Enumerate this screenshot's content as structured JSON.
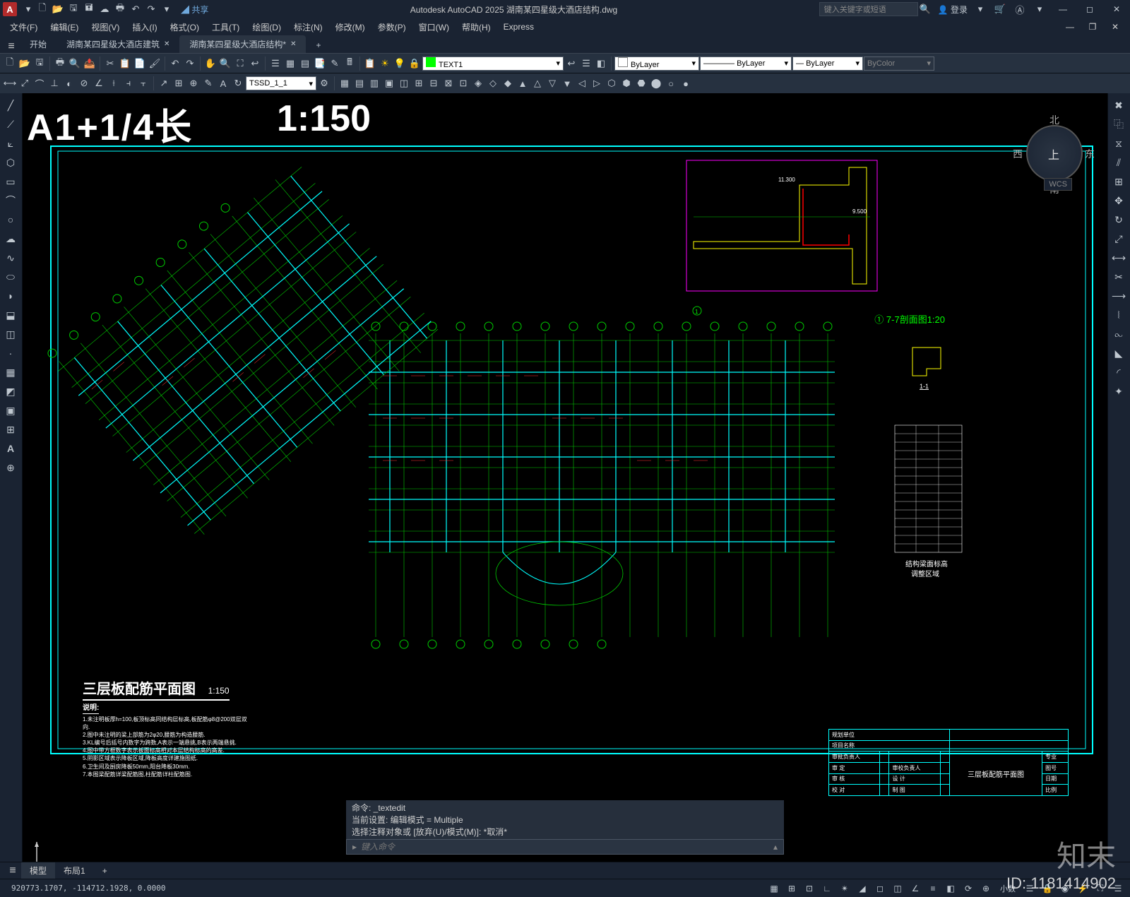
{
  "titlebar": {
    "app_letter": "A",
    "title": "Autodesk AutoCAD 2025   湖南某四星级大酒店结构.dwg",
    "share": "共享",
    "search_placeholder": "键入关键字或短语",
    "login": "登录"
  },
  "menus": [
    "文件(F)",
    "编辑(E)",
    "视图(V)",
    "插入(I)",
    "格式(O)",
    "工具(T)",
    "绘图(D)",
    "标注(N)",
    "修改(M)",
    "参数(P)",
    "窗口(W)",
    "帮助(H)",
    "Express"
  ],
  "tabs": {
    "items": [
      {
        "label": "开始",
        "active": false
      },
      {
        "label": "湖南某四星级大酒店建筑",
        "active": false
      },
      {
        "label": "湖南某四星级大酒店结构*",
        "active": true
      }
    ],
    "add": "+"
  },
  "toolbar1": {
    "layer_text": "TEXT1",
    "layer_color": "#00ff00",
    "bylayer1": "ByLayer",
    "bylayer2": "ByLayer",
    "bylayer3": "ByLayer",
    "bycolor": "ByColor"
  },
  "toolbar2": {
    "style": "TSSD_1_1"
  },
  "canvas": {
    "big_label": "A1+1/4长",
    "scale": "1:150",
    "drawing_title": "三层板配筋平面图",
    "drawing_scale": "1:150",
    "notes_title": "说明:",
    "notes_lines": [
      "1.未注明板厚h=100,板顶标高同结构层标高,板配筋φ8@200双层双向.",
      "2.图中未注明的梁上部筋为2φ20,腰筋为构造腰筋.",
      "3.KL编号后括号内数字为跨数,A表示一端悬挑,B表示两端悬挑.",
      "4.图中带方框数字表示板面标高相对本层结构标高的高差.",
      "5.阴影区域表示降板区域,降板高度详建施图纸.",
      "6.卫生间及厨房降板50mm,阳台降板30mm.",
      "7.本图梁配筋详梁配筋图,柱配筋详柱配筋图."
    ],
    "section_label": "①  7-7剖面图1:20",
    "compass": {
      "n": "北",
      "s": "南",
      "e": "东",
      "w": "西",
      "top": "上"
    },
    "wcs": "WCS",
    "section_small": "1-1",
    "legend_title": "结构梁面标高\n调整区域"
  },
  "titleblock": {
    "r1c1": "规划单位",
    "r2c1": "项目名称",
    "r3": [
      "审批负责人",
      "",
      "",
      "",
      "",
      "专业"
    ],
    "r4": [
      "审 定",
      "",
      "审校负责人",
      "",
      "三层板配筋平面图",
      "图号"
    ],
    "r5": [
      "审 核",
      "",
      "设 计",
      "",
      "",
      "日期"
    ],
    "r6": [
      "校 对",
      "",
      "制 图",
      "",
      "",
      "比例"
    ]
  },
  "cmd": {
    "hist1": "命令: _textedit",
    "hist2": "当前设置: 编辑模式 = Multiple",
    "hist3": "选择注释对象或 [放弃(U)/模式(M)]: *取消*",
    "prompt_icon": "▸",
    "placeholder": "键入命令"
  },
  "layout_tabs": {
    "model": "模型",
    "layout1": "布局1",
    "add": "+"
  },
  "statusbar": {
    "coords": "920773.1707, -114712.1928, 0.0000",
    "units": "小数"
  },
  "watermark": {
    "brand": "知末",
    "id_label": "ID: 1181414902"
  }
}
